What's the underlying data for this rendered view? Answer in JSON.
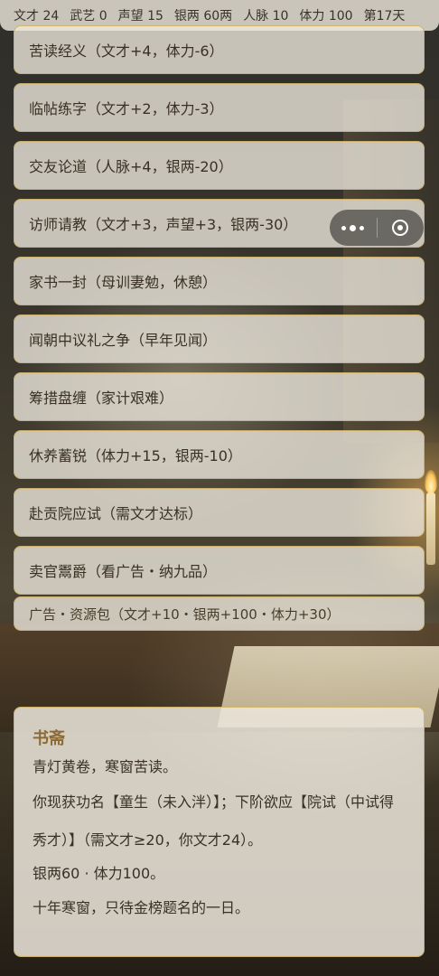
{
  "stats": {
    "wencai": "文才 24",
    "wuyi": "武艺 0",
    "shengwang": "声望 15",
    "yinliang": "银两 60两",
    "renmai": "人脉 10",
    "tili": "体力 100",
    "day": "第17天"
  },
  "actions": [
    "苦读经义（文才+4，体力-6）",
    "临帖练字（文才+2，体力-3）",
    "交友论道（人脉+4，银两-20）",
    "访师请教（文才+3，声望+3，银两-30）",
    "家书一封（母训妻勉，休憩）",
    "闻朝中议礼之争（早年见闻）",
    "筹措盘缠（家计艰难）",
    "休养蓄锐（体力+15，银两-10）",
    "赴贡院应试（需文才达标）",
    "卖官鬻爵（看广告・纳九品）",
    "广告・资源包（文才+10・银两+100・体力+30）"
  ],
  "capsule": {
    "more_icon": "more-dots-icon",
    "close_icon": "target-close-icon"
  },
  "panel": {
    "title": "书斋",
    "line1": "青灯黄卷，寒窗苦读。",
    "line2": "你现获功名【童生（未入泮）】；下阶欲应【院试（中试得秀才）】（需文才≥20，你文才24）。",
    "line3": "银两60 · 体力100。",
    "line4": "十年寒窗，只待金榜题名的一日。"
  },
  "colors": {
    "border": "#cdaa5a",
    "panel_title": "#8b6a34",
    "text": "#3a3024"
  }
}
